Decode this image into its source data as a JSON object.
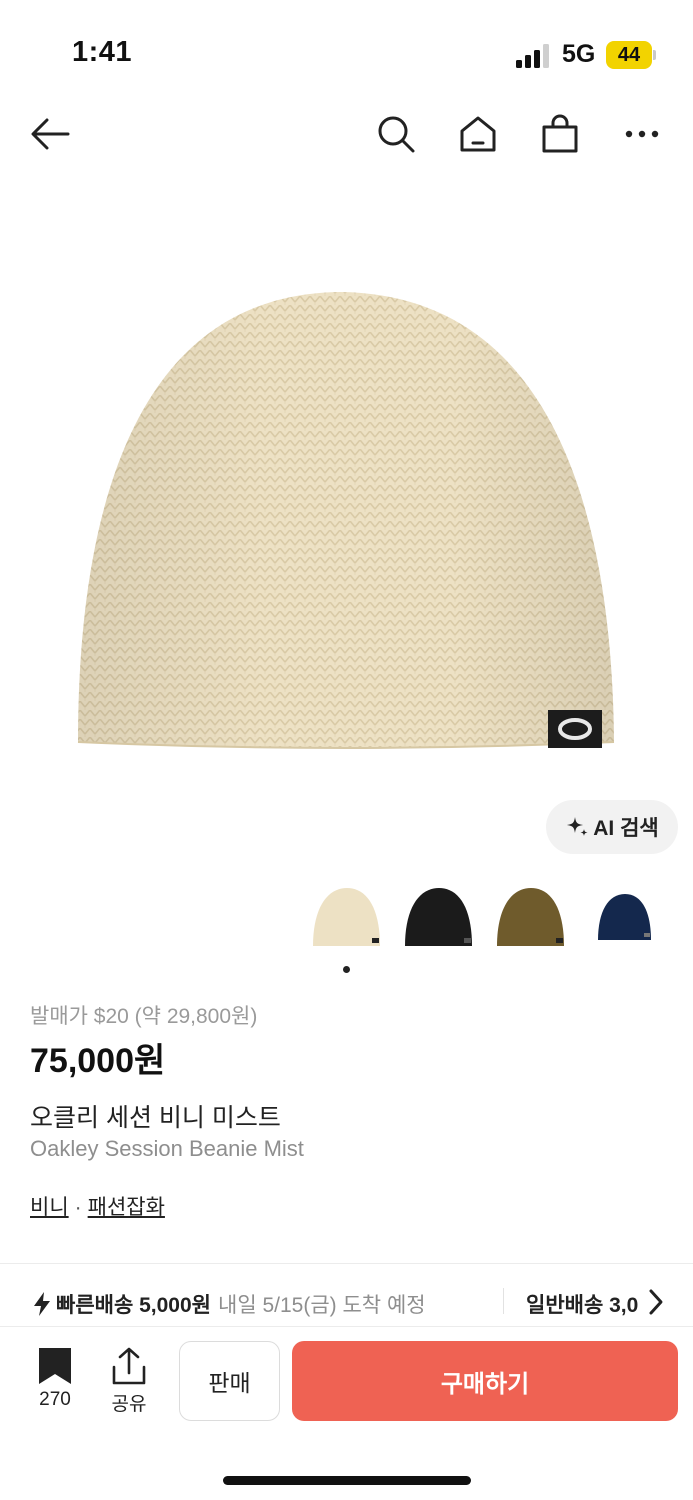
{
  "status_bar": {
    "time": "1:41",
    "network": "5G",
    "battery": "44"
  },
  "colors": {
    "accent": "#ef6253",
    "battery": "#f2d300",
    "muted": "#8e8e8e",
    "beanie_main": "#ede1c4"
  },
  "nav": {
    "icons": [
      "back-arrow-icon",
      "search-icon",
      "home-icon",
      "shopping-bag-icon",
      "more-icon"
    ]
  },
  "product": {
    "ai_search_label": "AI 검색",
    "colorways": [
      "mist",
      "black",
      "olive",
      "navy"
    ],
    "carousel_page": 1,
    "release_price": "발매가 $20 (약 29,800원)",
    "price": "75,000원",
    "name_ko": "오클리 세션 비니 미스트",
    "name_en": "Oakley Session Beanie Mist",
    "categories": [
      "비니",
      "패션잡화"
    ],
    "category_separator": "·"
  },
  "shipping": {
    "fast_label": "빠른배송 5,000원",
    "fast_eta": "내일 5/15(금) 도착 예정",
    "normal_label": "일반배송 3,0"
  },
  "actions": {
    "bookmark_count": "270",
    "share_label": "공유",
    "sell_label": "판매",
    "buy_label": "구매하기"
  }
}
